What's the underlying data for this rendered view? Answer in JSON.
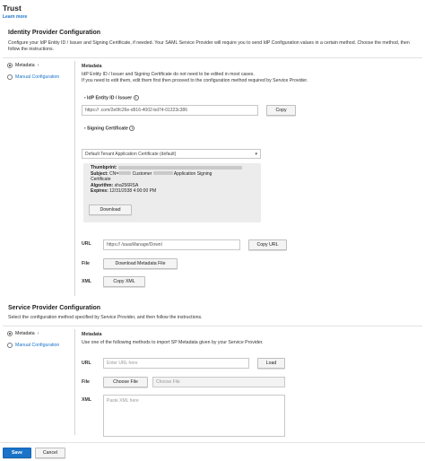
{
  "page": {
    "title": "Trust",
    "learn_more": "Learn more"
  },
  "idp": {
    "heading": "Identity Provider Configuration",
    "description": "Configure your IdP Entity ID / Issuer and Signing Certificate, if needed. Your SAML Service Provider will require you to send IdP Configuration values in a certain method. Choose the method, then follow the instructions.",
    "method_options": [
      "Metadata",
      "Manual Configuration"
    ],
    "selected_method": "Metadata",
    "metadata_title": "Metadata",
    "metadata_desc_1": "IdP Entity ID / Issuer and Signing Certificate do not need to be edited in most cases.",
    "metadata_desc_2": "If you need to edit them, edit them first then proceed to the configuration method required by Service Provider.",
    "entity_id_label": "IdP Entity ID / Issuer",
    "entity_id_value": "https://                        .com/2e0fc26e-d916-4002-bd74-01323c386",
    "copy_label": "Copy",
    "signing_cert_label": "Signing Certificate",
    "signing_cert_selected": "Default Tenant Application Certificate (default)",
    "cert": {
      "thumbprint_label": "Thumbprint:",
      "subject_label": "Subject:",
      "subject_value_a": "CN=",
      "subject_value_b": "Customer",
      "subject_value_c": "Application Signing",
      "subject_value_d": "Certificate",
      "algorithm_label": "Algorithm:",
      "algorithm_value": "sha256RSA",
      "expires_label": "Expires:",
      "expires_value": "12/31/2038 4:00:00 PM"
    },
    "download_label": "Download",
    "url_label": "URL",
    "url_value": "https://                                   /saasManage/Downl",
    "copy_url_label": "Copy URL",
    "file_label": "File",
    "download_metadata_label": "Download Metadata File",
    "xml_label": "XML",
    "copy_xml_label": "Copy XML"
  },
  "sp": {
    "heading": "Service Provider Configuration",
    "description": "Select the configuration method specified by Service Provider, and then follow the instructions.",
    "method_options": [
      "Metadata",
      "Manual Configuration"
    ],
    "selected_method": "Metadata",
    "metadata_title": "Metadata",
    "metadata_desc": "Use one of the following methods to import SP Metadata given by your Service Provider.",
    "url_label": "URL",
    "url_placeholder": "Enter URL here",
    "load_label": "Load",
    "file_label": "File",
    "choose_file_label": "Choose File",
    "choose_file_placeholder": "Choose File",
    "xml_label": "XML",
    "xml_placeholder": "Paste XML here"
  },
  "footer": {
    "save_label": "Save",
    "cancel_label": "Cancel"
  },
  "colors": {
    "accent": "#1a73c8",
    "cert_box_bg": "#ececec"
  }
}
